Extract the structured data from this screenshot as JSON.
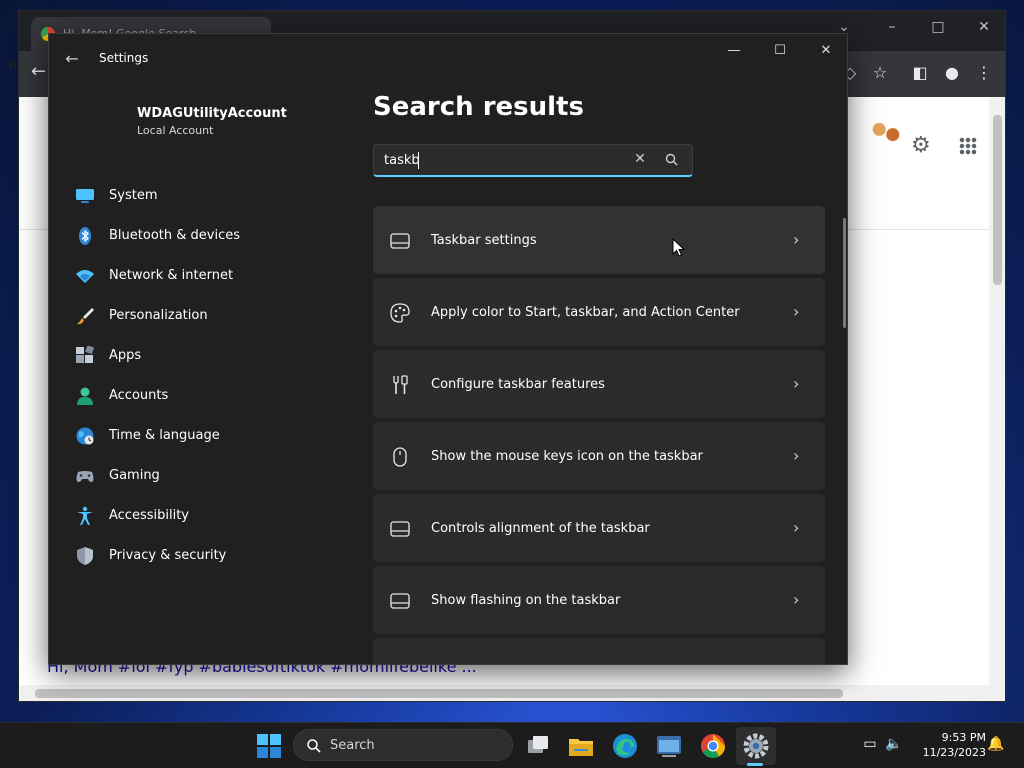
{
  "browser": {
    "tab_title": "Hi, Mom! Google Search",
    "edge_letter": "R",
    "bottom_text": "Hi, Mom #lol #fyp #babiesoftiktok #momlifebelike ..."
  },
  "settings": {
    "app_title": "Settings",
    "account": {
      "name": "WDAGUtilityAccount",
      "type": "Local Account"
    },
    "nav": [
      {
        "label": "System",
        "icon": "monitor-icon"
      },
      {
        "label": "Bluetooth & devices",
        "icon": "bluetooth-icon"
      },
      {
        "label": "Network & internet",
        "icon": "wifi-icon"
      },
      {
        "label": "Personalization",
        "icon": "brush-icon"
      },
      {
        "label": "Apps",
        "icon": "apps-grid-icon"
      },
      {
        "label": "Accounts",
        "icon": "person-icon"
      },
      {
        "label": "Time & language",
        "icon": "globe-clock-icon"
      },
      {
        "label": "Gaming",
        "icon": "gamepad-icon"
      },
      {
        "label": "Accessibility",
        "icon": "accessibility-icon"
      },
      {
        "label": "Privacy & security",
        "icon": "shield-icon"
      }
    ],
    "page_title": "Search results",
    "search": {
      "value": "taskb"
    },
    "results": [
      {
        "label": "Taskbar settings",
        "icon": "taskbar-icon"
      },
      {
        "label": "Apply color to Start, taskbar, and Action Center",
        "icon": "palette-icon"
      },
      {
        "label": "Configure taskbar features",
        "icon": "tools-icon"
      },
      {
        "label": "Show the mouse keys icon on the taskbar",
        "icon": "mouse-icon"
      },
      {
        "label": "Controls alignment of the taskbar",
        "icon": "taskbar-icon"
      },
      {
        "label": "Show flashing on the taskbar",
        "icon": "taskbar-icon"
      }
    ]
  },
  "taskbar": {
    "search_label": "Search",
    "time": "9:53 PM",
    "date": "11/23/2023"
  },
  "colors": {
    "accent": "#60cdff",
    "window_bg": "#202020",
    "card_bg": "#2b2b2b"
  }
}
